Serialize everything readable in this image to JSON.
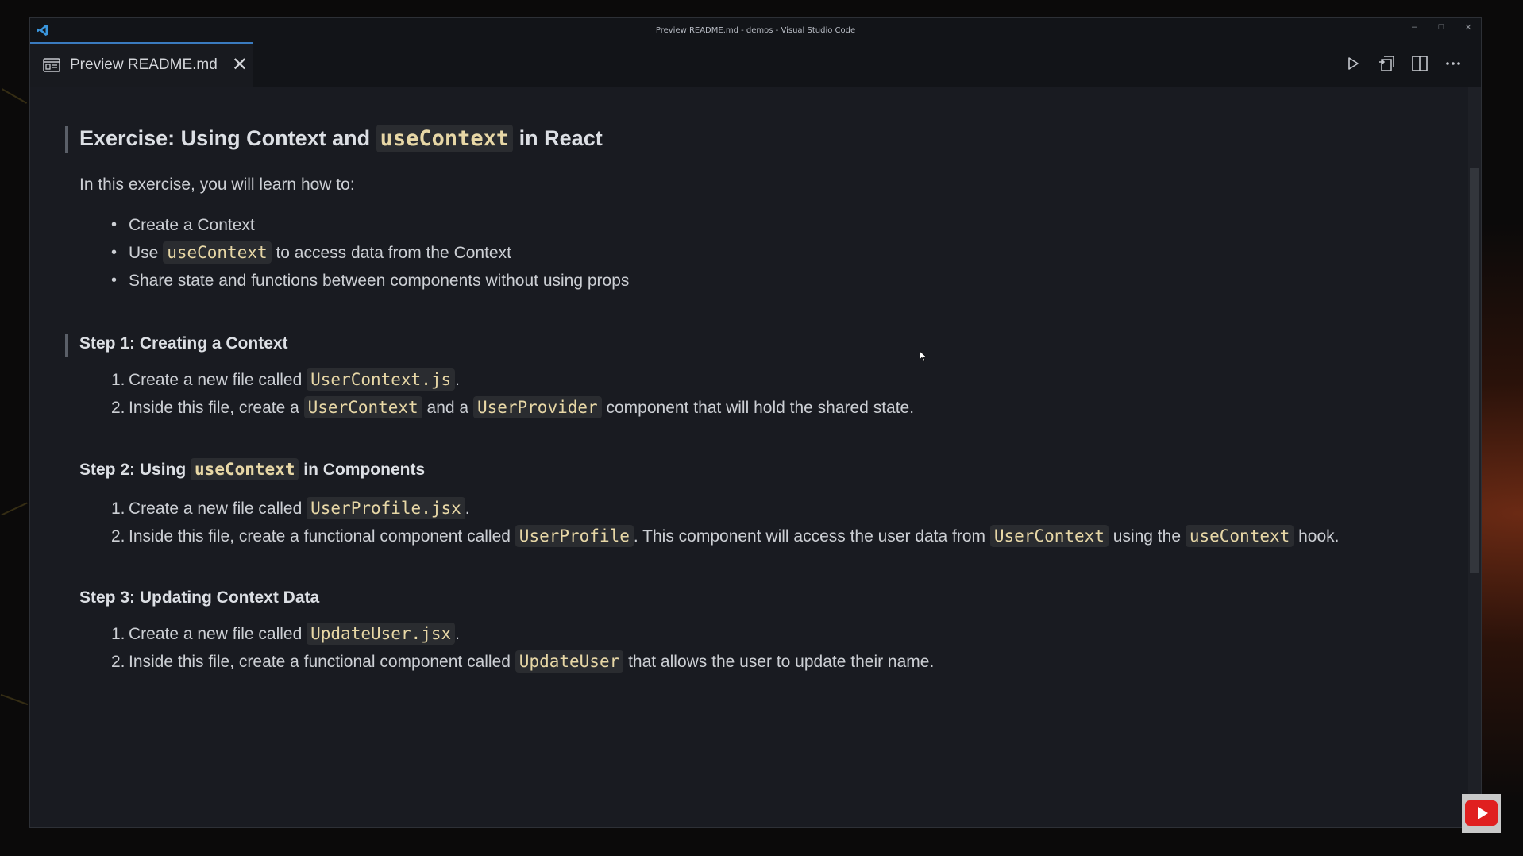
{
  "window": {
    "title": "Preview README.md - demos - Visual Studio Code",
    "controls": {
      "minimize": "–",
      "maximize": "□",
      "close": "✕"
    }
  },
  "tab": {
    "label": "Preview README.md",
    "close": "✕"
  },
  "actions": [
    "play-icon",
    "open-source-icon",
    "split-editor-icon",
    "more-actions-icon"
  ],
  "doc": {
    "h1": {
      "prefix": "Exercise: Using Context and ",
      "code": "useContext",
      "suffix": " in React"
    },
    "intro": "In this exercise, you will learn how to:",
    "bullets": [
      {
        "text": "Create a Context"
      },
      {
        "before": "Use ",
        "code": "useContext",
        "after": " to access data from the Context"
      },
      {
        "text": "Share state and functions between components without using props"
      }
    ],
    "step1": {
      "title": "Step 1: Creating a Context",
      "items": [
        {
          "num": "1.",
          "before": "Create a new file called ",
          "code1": "UserContext.js",
          "after": "."
        },
        {
          "num": "2.",
          "before": "Inside this file, create a ",
          "code1": "UserContext",
          "mid": " and a ",
          "code2": "UserProvider",
          "after": " component that will hold the shared state."
        }
      ]
    },
    "step2": {
      "prefix": "Step 2: Using ",
      "code": "useContext",
      "suffix": " in Components",
      "items": [
        {
          "num": "1.",
          "before": "Create a new file called ",
          "code1": "UserProfile.jsx",
          "after": "."
        },
        {
          "num": "2.",
          "before": "Inside this file, create a functional component called ",
          "code1": "UserProfile",
          "mid": ". This component will access the user data from ",
          "code2": "UserContext",
          "mid2": " using the ",
          "code3": "useContext",
          "after": " hook."
        }
      ]
    },
    "step3": {
      "title": "Step 3: Updating Context Data",
      "items": [
        {
          "num": "1.",
          "before": "Create a new file called ",
          "code1": "UpdateUser.jsx",
          "after": "."
        },
        {
          "num": "2.",
          "before": "Inside this file, create a functional component called ",
          "code1": "UpdateUser",
          "after": " that allows the user to update their name."
        }
      ]
    }
  },
  "colors": {
    "accent": "#3a7bbf",
    "code_text": "#e7d7a6",
    "editor_bg": "#191b21",
    "youtube_red": "#e02020"
  }
}
